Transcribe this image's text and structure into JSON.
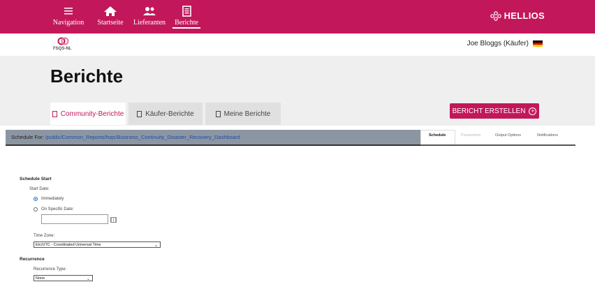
{
  "nav": {
    "items": [
      {
        "label": "Navigation",
        "icon": "hamburger-icon"
      },
      {
        "label": "Startseite",
        "icon": "home-icon"
      },
      {
        "label": "Lieferanten",
        "icon": "people-icon"
      },
      {
        "label": "Berichte",
        "icon": "report-icon",
        "active": true
      }
    ],
    "brand": "HELLIOS"
  },
  "header": {
    "logo_text": "FSQS-NL",
    "user": "Joe Bloggs  (Käufer)"
  },
  "page": {
    "title": "Berichte",
    "tabs": [
      {
        "label": "Community-Berichte"
      },
      {
        "label": "Käufer-Berichte"
      },
      {
        "label": "Meine Berichte"
      }
    ],
    "create_button": "BERICHT ERSTELLEN"
  },
  "schedule": {
    "for_label": "Schedule For:",
    "path": "/public/Common_Reports/fsqs/Business_Continuity_Disaster_Recovery_Dashboard",
    "subtabs": [
      "Schedule",
      "Parameters",
      "Output Options",
      "Notifications"
    ],
    "start_section": "Schedule Start",
    "start_date_label": "Start Date:",
    "opt_immediately": "Immediately",
    "opt_specific": "On Specific Date:",
    "date_value": "",
    "timezone_label": "Time Zone:",
    "timezone_value": "Etc/UTC - Coordinated Universal Time",
    "recurrence_section": "Recurrence",
    "recurrence_type_label": "Recurrence Type:",
    "recurrence_value": "None"
  },
  "colors": {
    "brand": "#c2185b",
    "link": "#1a4ea8"
  }
}
